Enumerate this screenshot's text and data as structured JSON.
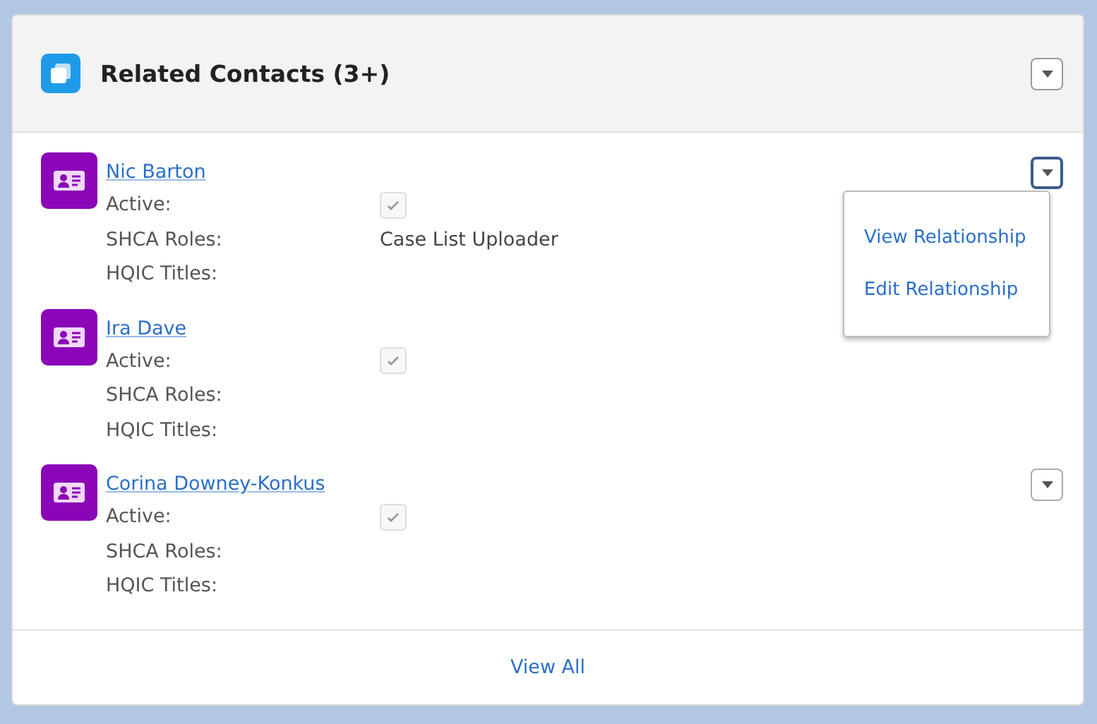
{
  "card": {
    "title": "Related Contacts (3+)",
    "header_button": {
      "expanded": false
    }
  },
  "contacts": [
    {
      "name": "Nic Barton",
      "active": true,
      "fields": [
        {
          "label": "Active:",
          "kind": "checkbox"
        },
        {
          "label": "SHCA Roles:",
          "kind": "text",
          "value": "Case List Uploader"
        },
        {
          "label": "HQIC Titles:",
          "kind": "text"
        }
      ],
      "button": {
        "expanded": true
      },
      "menu": [
        "View Relationship",
        "Edit Relationship"
      ]
    },
    {
      "name": "Ira Dave",
      "active": true,
      "fields": [
        {
          "label": "Active:",
          "kind": "checkbox"
        },
        {
          "label": "SHCA Roles:",
          "kind": "text"
        },
        {
          "label": "HQIC Titles:",
          "kind": "text"
        }
      ]
    },
    {
      "name": "Corina Downey-Konkus",
      "active": true,
      "fields": [
        {
          "label": "Active:",
          "kind": "checkbox"
        },
        {
          "label": "SHCA Roles:",
          "kind": "text"
        },
        {
          "label": "HQIC Titles:",
          "kind": "text"
        }
      ],
      "button": {
        "expanded": false
      }
    }
  ],
  "footer": {
    "link": "View All"
  }
}
